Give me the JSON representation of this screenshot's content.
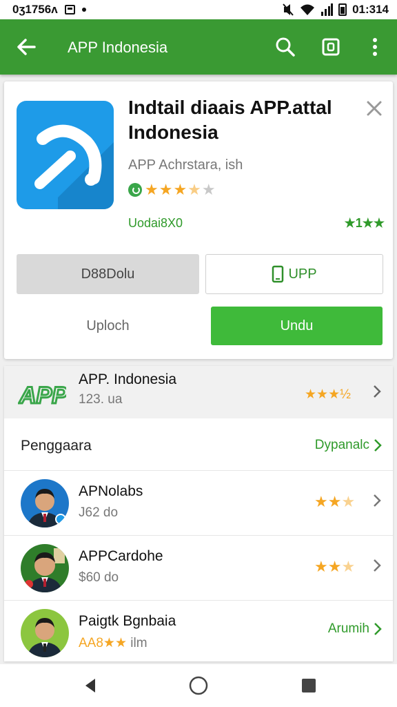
{
  "status_bar": {
    "time_left": "0ʒ1756ʌ",
    "time_right": "01:314",
    "dot": "•",
    "icons": [
      "storage-icon",
      "mute-icon",
      "wifi-icon",
      "signal-icon",
      "battery-icon"
    ]
  },
  "app_bar": {
    "title": "APP Indonesia",
    "icons": [
      "back-arrow-icon",
      "search-icon",
      "screenshot-icon",
      "more-vert-icon"
    ],
    "color": "#3a9a33"
  },
  "app_card": {
    "name": "Indtail diaais APP.attal Indonesia",
    "developer": "APP Achrstara, ish",
    "rating": {
      "stars": 3.5,
      "max": 5
    },
    "update_label": "Uodai8X0",
    "rank_label": "★1★★",
    "close_icon": "close-icon",
    "buttons": {
      "secondary": "D88Dolu",
      "open": "UPP",
      "text": "Uploch",
      "primary": "Undu"
    },
    "colors": {
      "icon_bg": "#1e9be8",
      "primary": "#3fba3a",
      "accent_text": "#2f9a2a"
    }
  },
  "featured": {
    "title": "APP. Indonesia",
    "subtitle": "123. ua",
    "stars_label": "★★★½",
    "logo_text": "APP"
  },
  "section": {
    "label": "Penggaara",
    "more": "Dypanalc"
  },
  "people": [
    {
      "name": "APNolabs",
      "sub": "J62 do",
      "rating": 2.5,
      "sub_color": "#2f9a2a"
    },
    {
      "name": "APPCardohe",
      "sub": "$60 do",
      "rating": 2.5,
      "sub_color": "#2f9a2a"
    },
    {
      "name": "Paigtk Bgnbaia",
      "sub_prefix": "AA8★★",
      "sub_suffix": " ilm",
      "action": "Arumih"
    }
  ],
  "nav_bar": {
    "icons": [
      "back-triangle-icon",
      "home-circle-icon",
      "recents-square-icon"
    ]
  }
}
